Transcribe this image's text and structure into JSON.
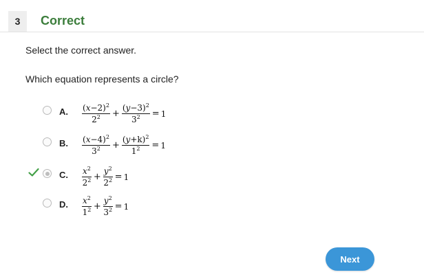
{
  "header": {
    "question_number": "3",
    "status": "Correct"
  },
  "instruction": "Select the correct answer.",
  "question": "Which equation represents a circle?",
  "choices": [
    {
      "letter": "A.",
      "selected": false,
      "correct": false,
      "eq": {
        "n1a": "(",
        "n1v": "x",
        "n1b": "−2)",
        "n1e": "2",
        "d1": "2",
        "d1e": "2",
        "op": "+",
        "n2a": "(",
        "n2v": "y",
        "n2b": "−3)",
        "n2e": "2",
        "d2": "3",
        "d2e": "2",
        "eq": "=",
        "rhs": "1"
      }
    },
    {
      "letter": "B.",
      "selected": false,
      "correct": false,
      "eq": {
        "n1a": "(",
        "n1v": "x",
        "n1b": "−4)",
        "n1e": "2",
        "d1": "3",
        "d1e": "2",
        "op": "+",
        "n2a": "(",
        "n2v": "y",
        "n2b": "+k)",
        "n2e": "2",
        "d2": "1",
        "d2e": "2",
        "eq": "=",
        "rhs": "1"
      }
    },
    {
      "letter": "C.",
      "selected": true,
      "correct": true,
      "eq": {
        "n1v": "x",
        "n1e": "2",
        "d1": "2",
        "d1e": "2",
        "op": "+",
        "n2v": "y",
        "n2e": "2",
        "d2": "2",
        "d2e": "2",
        "eq": "=",
        "rhs": "1"
      }
    },
    {
      "letter": "D.",
      "selected": false,
      "correct": false,
      "eq": {
        "n1v": "x",
        "n1e": "2",
        "d1": "1",
        "d1e": "2",
        "op": "+",
        "n2v": "y",
        "n2e": "2",
        "d2": "3",
        "d2e": "2",
        "eq": "=",
        "rhs": "1"
      }
    }
  ],
  "colors": {
    "status": "#3b7d3b",
    "check": "#43a047",
    "button": "#3b96d8"
  },
  "icons": {
    "check": "checkmark-icon"
  },
  "next_label": "Next"
}
